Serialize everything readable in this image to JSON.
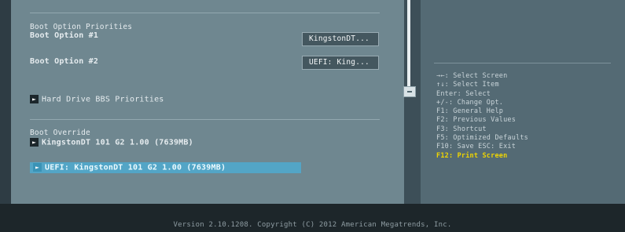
{
  "main": {
    "boot_priorities_heading": "Boot Option Priorities",
    "boot_option_1_label": "Boot Option #1",
    "boot_option_1_value": "KingstonDT...",
    "boot_option_2_label": "Boot Option #2",
    "boot_option_2_value": "UEFI: King...",
    "hdd_priorities_label": "Hard Drive BBS Priorities",
    "boot_override_heading": "Boot Override",
    "override_items": [
      "KingstonDT 101 G2 1.00  (7639MB)",
      "UEFI: KingstonDT 101 G2 1.00 (7639MB)"
    ]
  },
  "help": {
    "items": [
      "→←: Select Screen",
      "↑↓: Select Item",
      "Enter: Select",
      "+/-: Change Opt.",
      "F1: General Help",
      "F2: Previous Values",
      "F3: Shortcut",
      "F5: Optimized Defaults",
      "F10: Save  ESC: Exit",
      "F12: Print Screen"
    ]
  },
  "footer": {
    "version": "Version 2.10.1208. Copyright (C) 2012 American Megatrends, Inc."
  },
  "colors": {
    "left_panel": "#6f8790",
    "right_panel": "#546a74",
    "selection": "#53a5c6",
    "highlight_text": "#f0d500"
  }
}
